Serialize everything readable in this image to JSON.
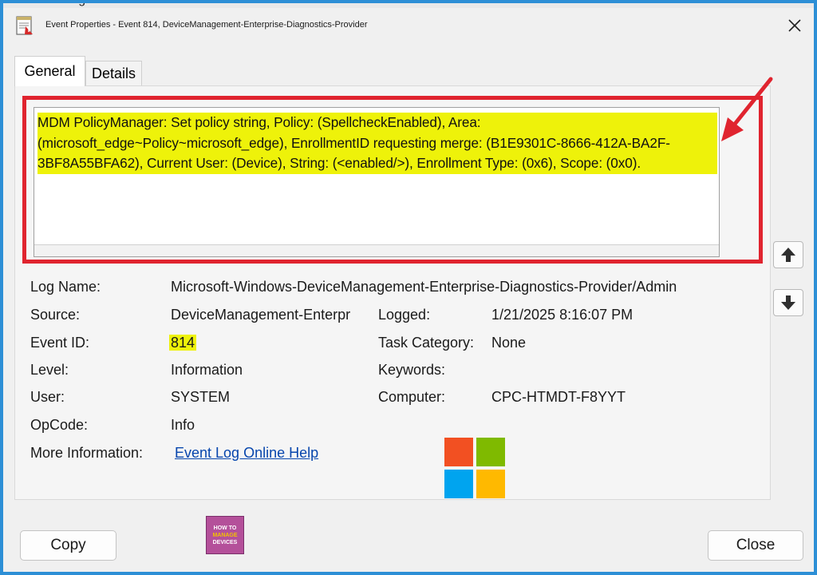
{
  "background_text": "ent-Licensing",
  "window": {
    "title": "Event Properties - Event 814, DeviceManagement-Enterprise-Diagnostics-Provider",
    "close_glyph": "✕"
  },
  "tabs": [
    {
      "label": "General",
      "active": true
    },
    {
      "label": "Details",
      "active": false
    }
  ],
  "description": "MDM PolicyManager: Set policy string, Policy: (SpellcheckEnabled), Area: (microsoft_edge~Policy~microsoft_edge), EnrollmentID requesting merge: (B1E9301C-8666-412A-BA2F-3BF8A55BFA62), Current User: (Device), String: (<enabled/>), Enrollment Type: (0x6), Scope: (0x0).",
  "details": {
    "log_name": {
      "label": "Log Name:",
      "value": "Microsoft-Windows-DeviceManagement-Enterprise-Diagnostics-Provider/Admin"
    },
    "source": {
      "label": "Source:",
      "value": "DeviceManagement-Enterpr"
    },
    "logged": {
      "label": "Logged:",
      "value": "1/21/2025 8:16:07 PM"
    },
    "event_id": {
      "label": "Event ID:",
      "value": "814"
    },
    "task_category": {
      "label": "Task Category:",
      "value": "None"
    },
    "level": {
      "label": "Level:",
      "value": "Information"
    },
    "keywords": {
      "label": "Keywords:",
      "value": ""
    },
    "user": {
      "label": "User:",
      "value": "SYSTEM"
    },
    "computer": {
      "label": "Computer:",
      "value": "CPC-HTMDT-F8YYT"
    },
    "opcode": {
      "label": "OpCode:",
      "value": "Info"
    },
    "more_info": {
      "label": "More Information:",
      "link": "Event Log Online Help"
    }
  },
  "watermark": {
    "line1": "HOW TO",
    "line2": "MANAGE",
    "line3": "DEVICES"
  },
  "buttons": {
    "copy": "Copy",
    "close": "Close"
  },
  "colors": {
    "highlight": "#eef20a",
    "annotation_red": "#e0242f",
    "link": "#0645ad",
    "ms_red": "#f25022",
    "ms_green": "#7fba00",
    "ms_blue": "#00a4ef",
    "ms_yellow": "#ffb900"
  },
  "icons": {
    "app": "event-viewer-icon",
    "scroll_up": "arrow-up-icon",
    "scroll_down": "arrow-down-icon",
    "annotation": "red-arrow-icon",
    "logo": "microsoft-logo-icon"
  }
}
